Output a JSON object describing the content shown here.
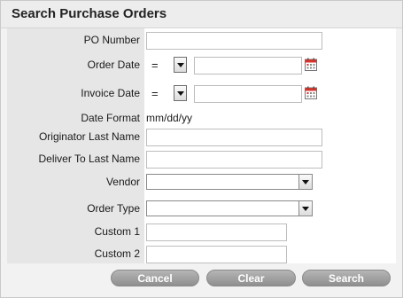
{
  "title": "Search Purchase Orders",
  "fields": {
    "po_number": {
      "label": "PO Number",
      "value": ""
    },
    "order_date": {
      "label": "Order Date",
      "operator": "=",
      "value": ""
    },
    "invoice_date": {
      "label": "Invoice Date",
      "operator": "=",
      "value": ""
    },
    "date_format": {
      "label": "Date Format",
      "value": "mm/dd/yy"
    },
    "originator_last_name": {
      "label": "Originator Last Name",
      "value": ""
    },
    "deliver_to_last_name": {
      "label": "Deliver To Last Name",
      "value": ""
    },
    "vendor": {
      "label": "Vendor",
      "selected": ""
    },
    "order_type": {
      "label": "Order Type",
      "selected": ""
    },
    "custom1": {
      "label": "Custom 1",
      "value": ""
    },
    "custom2": {
      "label": "Custom 2",
      "value": ""
    }
  },
  "buttons": {
    "cancel": "Cancel",
    "clear": "Clear",
    "search": "Search"
  },
  "colors": {
    "button_bg": "#9e9e9e",
    "label_column_bg": "#e6e6e6",
    "calendar_accent": "#d9332b"
  },
  "icons": {
    "calendar": "calendar-icon",
    "dropdown": "chevron-down-icon"
  }
}
